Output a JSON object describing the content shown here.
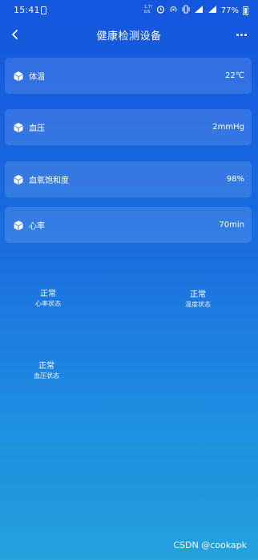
{
  "status_bar": {
    "time": "15:41",
    "network_speed": "1.77\nK/S",
    "battery_percent": "77%"
  },
  "header": {
    "title": "健康检测设备",
    "back_icon": "chevron-left-icon",
    "more_icon": "more-horizontal-icon"
  },
  "metrics": [
    {
      "label": "体温",
      "value": "22℃",
      "icon": "cube-icon"
    },
    {
      "label": "血压",
      "value": "2mmHg",
      "icon": "cube-icon"
    },
    {
      "label": "血氧饱和度",
      "value": "98%",
      "icon": "cube-icon"
    },
    {
      "label": "心率",
      "value": "70min",
      "icon": "cube-icon"
    }
  ],
  "statuses": [
    {
      "value": "正常",
      "label": "心率状态"
    },
    {
      "value": "正常",
      "label": "温度状态"
    },
    {
      "value": "正常",
      "label": "血压状态"
    }
  ],
  "watermark": "CSDN @cookapk"
}
